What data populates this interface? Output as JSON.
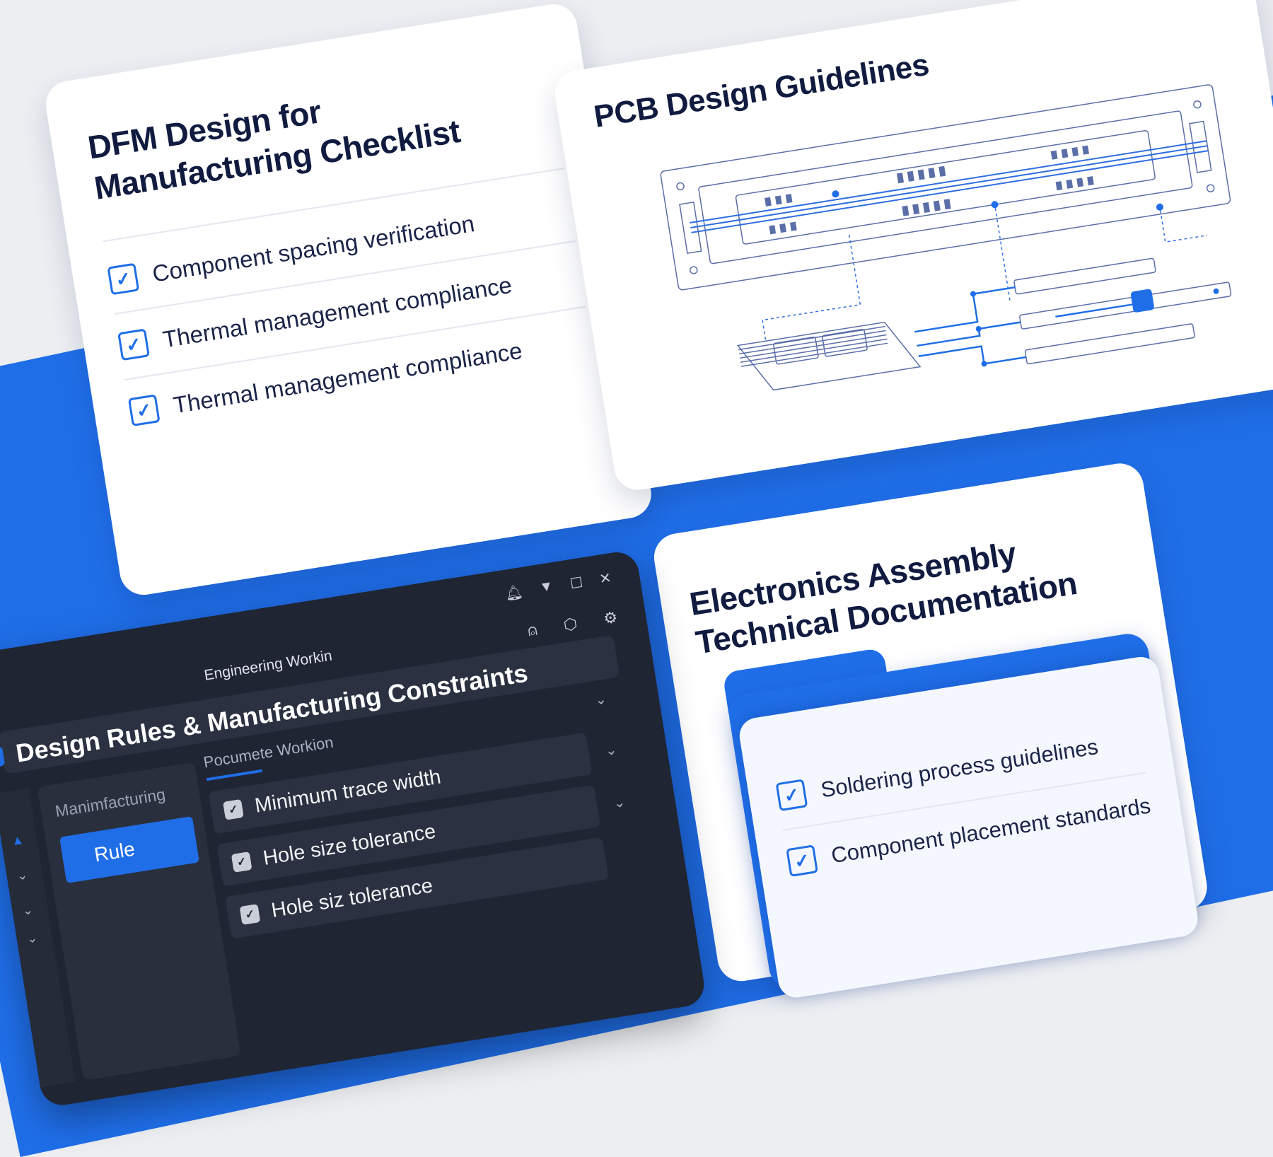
{
  "cards": {
    "dfm": {
      "title_line1": "DFM Design for",
      "title_line2": "Manufacturing Checklist",
      "items": [
        {
          "label": "Component spacing verification",
          "checked": true
        },
        {
          "label": "Thermal management compliance",
          "checked": true
        },
        {
          "label": "Thermal management compliance",
          "checked": true
        }
      ]
    },
    "pcb": {
      "title": "PCB Design Guidelines"
    },
    "assembly": {
      "title_line1": "Electronics Assembly",
      "title_line2": "Technical Documentation",
      "items": [
        {
          "label": "Soldering process guidelines",
          "checked": true
        },
        {
          "label": "Component placement standards",
          "checked": true
        }
      ]
    }
  },
  "window": {
    "app_name": "Engineering Workin",
    "title": "Design Rules & Manufacturing Constraints",
    "sidebar": {
      "heading": "Manimfacturing",
      "selected": "Rule"
    },
    "panel": {
      "heading": "Pocumete Workion",
      "rules": [
        {
          "label": "Minimum trace width"
        },
        {
          "label": "Hole size tolerance"
        },
        {
          "label": "Hole siz tolerance"
        }
      ]
    }
  },
  "colors": {
    "accent": "#1f6ee8",
    "card_title": "#111b3f",
    "window_bg": "#202533"
  },
  "icons": {
    "check": "checkmark-icon",
    "bell": "bell-icon",
    "user": "user-icon",
    "settings": "gear-icon"
  }
}
